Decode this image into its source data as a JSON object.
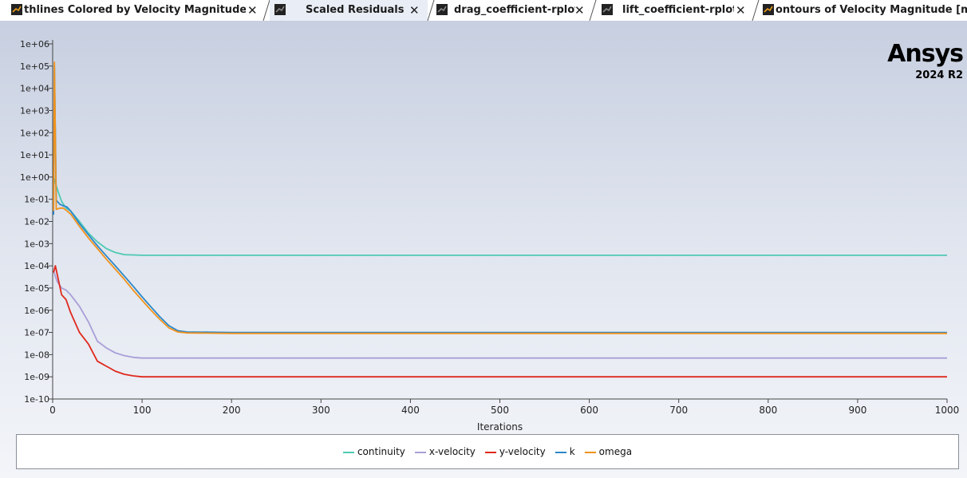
{
  "tabs": [
    {
      "label": "thlines Colored by Velocity Magnitude [m/",
      "close": "✕",
      "icon": "plot-tab-icon",
      "active": false
    },
    {
      "label": "Scaled Residuals",
      "close": "✕",
      "icon": "plot-tab-icon",
      "active": true
    },
    {
      "label": "drag_coefficient-rplot",
      "close": "✕",
      "icon": "plot-tab-icon",
      "active": false
    },
    {
      "label": "lift_coefficient-rplot",
      "close": "✕",
      "icon": "plot-tab-icon",
      "active": false
    },
    {
      "label": "ontours of Velocity Magnitude [m/s",
      "close": "",
      "icon": "plot-tab-icon",
      "active": false
    }
  ],
  "logo": {
    "name": "Ansys",
    "version": "2024 R2"
  },
  "chart_data": {
    "type": "line",
    "title": "",
    "xlabel": "Iterations",
    "ylabel": "",
    "xlim": [
      0,
      1000
    ],
    "ylim": [
      1e-10,
      1000000.0
    ],
    "yscale": "log",
    "grid": false,
    "legend_position": "bottom",
    "xticks": [
      "0",
      "100",
      "200",
      "300",
      "400",
      "500",
      "600",
      "700",
      "800",
      "900",
      "1000"
    ],
    "yticks": [
      "1e-10",
      "1e-09",
      "1e-08",
      "1e-07",
      "1e-06",
      "1e-05",
      "1e-04",
      "1e-03",
      "1e-02",
      "1e-01",
      "1e+00",
      "1e+01",
      "1e+02",
      "1e+03",
      "1e+04",
      "1e+05",
      "1e+06"
    ],
    "series": [
      {
        "name": "continuity",
        "color": "#4fc9b4",
        "x": [
          1,
          5,
          10,
          15,
          20,
          30,
          40,
          50,
          60,
          70,
          80,
          100,
          150,
          200,
          300,
          400,
          500,
          600,
          700,
          800,
          900,
          1000
        ],
        "y": [
          1.0,
          0.3,
          0.08,
          0.04,
          0.03,
          0.01,
          0.003,
          0.0012,
          0.0006,
          0.0004,
          0.00032,
          0.0003,
          0.0003,
          0.0003,
          0.0003,
          0.0003,
          0.0003,
          0.0003,
          0.0003,
          0.0003,
          0.0003,
          0.0003
        ]
      },
      {
        "name": "x-velocity",
        "color": "#a89ed8",
        "x": [
          1,
          5,
          10,
          15,
          20,
          30,
          40,
          50,
          60,
          70,
          80,
          90,
          100,
          150,
          200,
          300,
          400,
          500,
          600,
          700,
          800,
          900,
          1000
        ],
        "y": [
          6e-05,
          2e-05,
          1e-05,
          8e-06,
          5e-06,
          1.5e-06,
          3e-07,
          4e-08,
          2e-08,
          1.2e-08,
          9e-09,
          7.5e-09,
          7e-09,
          7e-09,
          7e-09,
          7e-09,
          7e-09,
          7e-09,
          7e-09,
          7e-09,
          7e-09,
          7e-09,
          7e-09
        ]
      },
      {
        "name": "y-velocity",
        "color": "#e0281c",
        "x": [
          1,
          3,
          10,
          15,
          20,
          30,
          40,
          50,
          60,
          70,
          80,
          90,
          100,
          150,
          200,
          300,
          400,
          500,
          600,
          700,
          800,
          900,
          1000
        ],
        "y": [
          5e-05,
          0.0001,
          5e-06,
          3e-06,
          8e-07,
          1e-07,
          3e-08,
          5e-09,
          3e-09,
          1.8e-09,
          1.3e-09,
          1.1e-09,
          1e-09,
          1e-09,
          1e-09,
          1e-09,
          1e-09,
          1e-09,
          1e-09,
          1e-09,
          1e-09,
          1e-09,
          1e-09
        ]
      },
      {
        "name": "k",
        "color": "#2b87c8",
        "x": [
          1,
          2,
          4,
          8,
          12,
          16,
          20,
          30,
          40,
          50,
          60,
          70,
          80,
          90,
          100,
          110,
          120,
          130,
          140,
          150,
          200,
          300,
          400,
          500,
          600,
          700,
          800,
          900,
          1000
        ],
        "y": [
          0.02,
          100000.0,
          0.09,
          0.06,
          0.05,
          0.045,
          0.03,
          0.008,
          0.0025,
          0.0008,
          0.00028,
          0.0001,
          3.5e-05,
          1.2e-05,
          4e-06,
          1.4e-06,
          5e-07,
          2e-07,
          1.2e-07,
          1.05e-07,
          1e-07,
          1e-07,
          1e-07,
          1e-07,
          1e-07,
          1e-07,
          1e-07,
          1e-07,
          1e-07
        ]
      },
      {
        "name": "omega",
        "color": "#f0921c",
        "x": [
          1,
          2,
          4,
          8,
          12,
          16,
          20,
          30,
          40,
          50,
          60,
          70,
          80,
          90,
          100,
          110,
          120,
          130,
          140,
          150,
          200,
          300,
          400,
          500,
          600,
          700,
          800,
          900,
          1000
        ],
        "y": [
          0.03,
          150000.0,
          0.035,
          0.04,
          0.04,
          0.03,
          0.022,
          0.006,
          0.0018,
          0.0006,
          0.0002,
          7e-05,
          2.5e-05,
          8e-06,
          2.8e-06,
          1e-06,
          3.8e-07,
          1.6e-07,
          1.05e-07,
          9.5e-08,
          9e-08,
          9e-08,
          9e-08,
          9e-08,
          9e-08,
          9e-08,
          9e-08,
          9e-08,
          9e-08
        ]
      }
    ]
  }
}
